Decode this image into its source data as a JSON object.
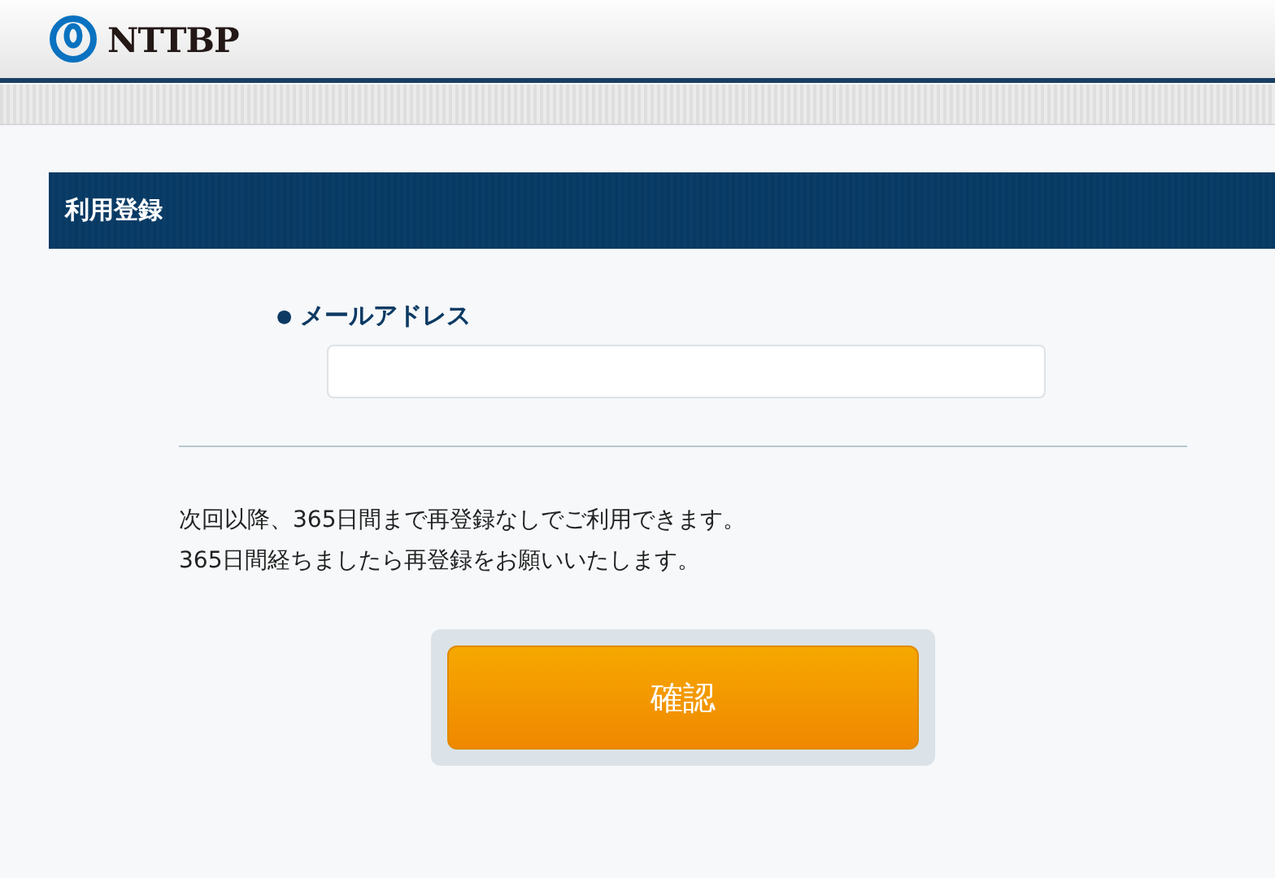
{
  "header": {
    "logo_text": "NTTBP"
  },
  "section": {
    "title": "利用登録"
  },
  "form": {
    "label": "メールアドレス",
    "bullet": "●"
  },
  "notice": [
    "次回以降、365日間まで再登録なしでご利用できます。",
    "365日間経ちましたら再登録をお願いいたします。"
  ],
  "submit": {
    "label": "確認"
  }
}
